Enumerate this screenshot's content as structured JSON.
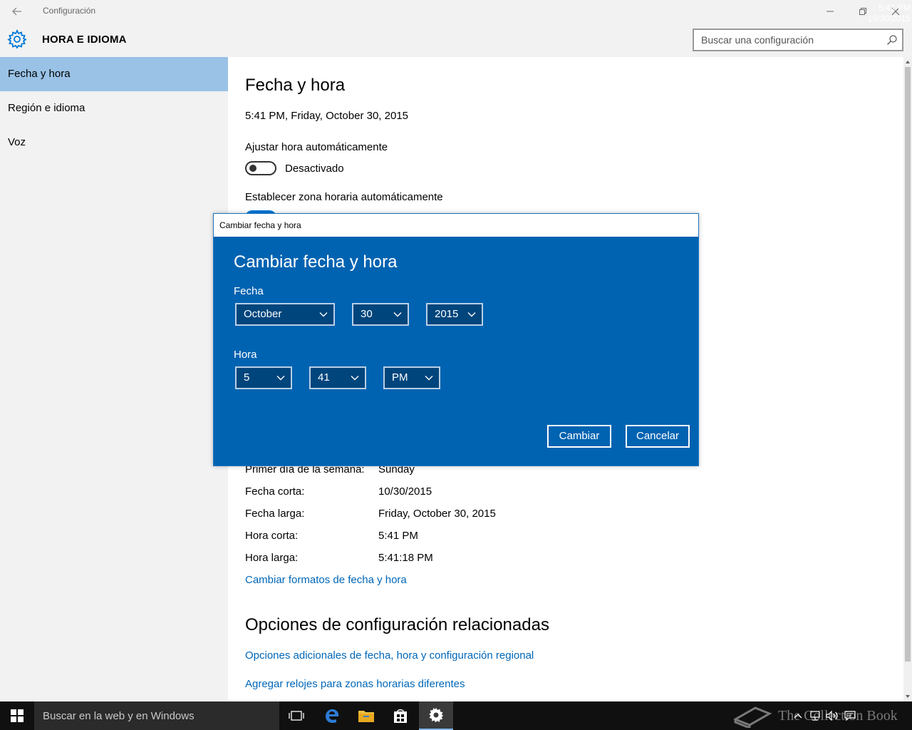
{
  "window": {
    "title": "Configuración",
    "section_title": "HORA E IDIOMA",
    "search_placeholder": "Buscar una configuración"
  },
  "sidebar": {
    "items": [
      {
        "label": "Fecha y hora",
        "active": true
      },
      {
        "label": "Región e idioma",
        "active": false
      },
      {
        "label": "Voz",
        "active": false
      }
    ]
  },
  "main": {
    "heading": "Fecha y hora",
    "current_datetime": "5:41 PM, Friday, October 30, 2015",
    "auto_time_label": "Ajustar hora automáticamente",
    "auto_time_state": "Desactivado",
    "auto_timezone_label": "Establecer zona horaria automáticamente",
    "formats": [
      {
        "label": "Primer día de la semana:",
        "value": "Sunday"
      },
      {
        "label": "Fecha corta:",
        "value": "10/30/2015"
      },
      {
        "label": "Fecha larga:",
        "value": "Friday, October 30, 2015"
      },
      {
        "label": "Hora corta:",
        "value": "5:41 PM"
      },
      {
        "label": "Hora larga:",
        "value": "5:41:18 PM"
      }
    ],
    "change_formats_link": "Cambiar formatos de fecha y hora",
    "related_heading": "Opciones de configuración relacionadas",
    "related_links": [
      "Opciones adicionales de fecha, hora y configuración regional",
      "Agregar relojes para zonas horarias diferentes"
    ]
  },
  "dialog": {
    "window_title": "Cambiar fecha y hora",
    "heading": "Cambiar fecha y hora",
    "date_label": "Fecha",
    "month": "October",
    "day": "30",
    "year": "2015",
    "time_label": "Hora",
    "hour": "5",
    "minute": "41",
    "ampm": "PM",
    "ok_button": "Cambiar",
    "cancel_button": "Cancelar"
  },
  "taskbar": {
    "search_placeholder": "Buscar en la web y en Windows",
    "clock_time": "5:41 PM",
    "clock_date": "10/30/2015",
    "watermark": "The Collection Book"
  },
  "colors": {
    "accent": "#0078d7",
    "dialog_bg": "#0063b1",
    "sidebar_active": "#99c2e6",
    "link": "#0067b8"
  }
}
